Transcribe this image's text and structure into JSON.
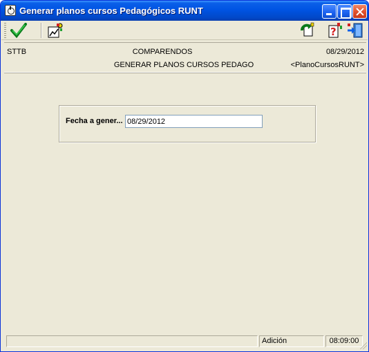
{
  "window": {
    "title": "Generar planos cursos Pedagógicos RUNT"
  },
  "toolbar": {
    "icons": [
      "accept-check-icon",
      "chart-icon",
      "refresh-icon",
      "help-icon",
      "exit-door-icon"
    ]
  },
  "header": {
    "left": "STTB",
    "center": "COMPARENDOS",
    "date": "08/29/2012",
    "subtitle": "GENERAR PLANOS CURSOS PEDAGO",
    "program": "<PlanoCursosRUNT>"
  },
  "form": {
    "fecha_label": "Fecha a gener...",
    "fecha_value": "08/29/2012"
  },
  "statusbar": {
    "message": "",
    "mode": "Adición",
    "time": "08:09:00"
  },
  "colors": {
    "titlebar": "#0054e3",
    "face": "#ece9d8",
    "close": "#e2532f"
  }
}
